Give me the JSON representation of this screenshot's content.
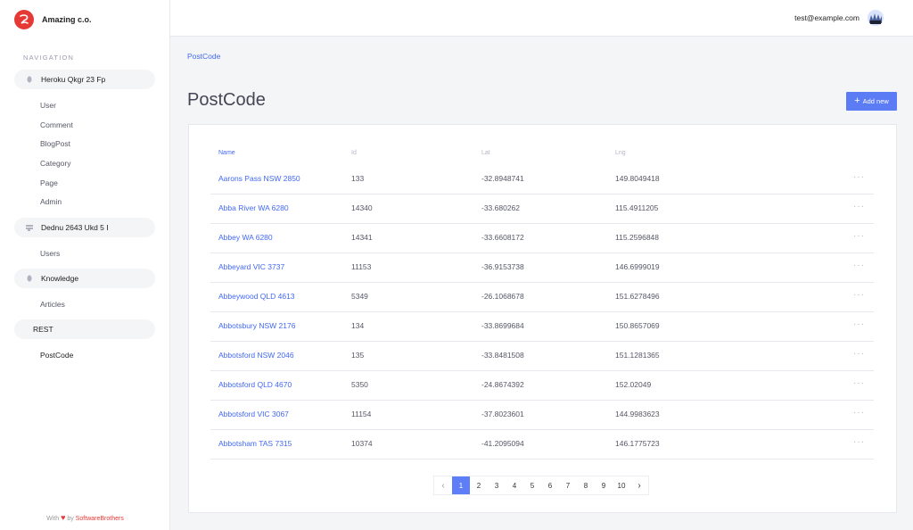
{
  "app": {
    "brand_name": "Amazing c.o.",
    "brand_color": "#e53935",
    "accent_color": "#4268F6"
  },
  "sidebar": {
    "nav_title": "Navigation",
    "groups": [
      {
        "label": "Heroku Qkgr 23 Fp",
        "icon": "database-icon",
        "items": [
          "User",
          "Comment",
          "BlogPost",
          "Category",
          "Page",
          "Admin"
        ]
      },
      {
        "label": "Dednu 2643 Ukd 5 I",
        "icon": "list-icon",
        "items": [
          "Users"
        ]
      },
      {
        "label": "Knowledge",
        "icon": "database-icon",
        "items": [
          "Articles"
        ]
      },
      {
        "label": "REST",
        "icon": "",
        "items": [
          "PostCode"
        ]
      }
    ],
    "footer": {
      "prefix": "With",
      "heart_icon": "heart-icon",
      "by": "by",
      "link": "SoftwareBrothers"
    }
  },
  "topbar": {
    "user_email": "test@example.com",
    "avatar_icon": "avatar-icon"
  },
  "breadcrumb": {
    "label": "PostCode"
  },
  "page": {
    "title": "PostCode",
    "add_button_label": "Add new",
    "add_button_icon": "plus-icon"
  },
  "table": {
    "headers": {
      "name": "Name",
      "id": "Id",
      "lat": "Lat",
      "lng": "Lng"
    },
    "rows": [
      {
        "name": "Aarons Pass NSW 2850",
        "id": "133",
        "lat": "-32.8948741",
        "lng": "149.8049418"
      },
      {
        "name": "Abba River WA 6280",
        "id": "14340",
        "lat": "-33.680262",
        "lng": "115.4911205"
      },
      {
        "name": "Abbey WA 6280",
        "id": "14341",
        "lat": "-33.6608172",
        "lng": "115.2596848"
      },
      {
        "name": "Abbeyard VIC 3737",
        "id": "11153",
        "lat": "-36.9153738",
        "lng": "146.6999019"
      },
      {
        "name": "Abbeywood QLD 4613",
        "id": "5349",
        "lat": "-26.1068678",
        "lng": "151.6278496"
      },
      {
        "name": "Abbotsbury NSW 2176",
        "id": "134",
        "lat": "-33.8699684",
        "lng": "150.8657069"
      },
      {
        "name": "Abbotsford NSW 2046",
        "id": "135",
        "lat": "-33.8481508",
        "lng": "151.1281365"
      },
      {
        "name": "Abbotsford QLD 4670",
        "id": "5350",
        "lat": "-24.8674392",
        "lng": "152.02049"
      },
      {
        "name": "Abbotsford VIC 3067",
        "id": "11154",
        "lat": "-37.8023601",
        "lng": "144.9983623"
      },
      {
        "name": "Abbotsham TAS 7315",
        "id": "10374",
        "lat": "-41.2095094",
        "lng": "146.1775723"
      }
    ],
    "row_actions_label": "···"
  },
  "pagination": {
    "prev_icon": "chevron-left-icon",
    "next_icon": "chevron-right-icon",
    "prev_glyph": "‹",
    "next_glyph": "›",
    "pages": [
      "1",
      "2",
      "3",
      "4",
      "5",
      "6",
      "7",
      "8",
      "9",
      "10"
    ],
    "current": "1"
  }
}
